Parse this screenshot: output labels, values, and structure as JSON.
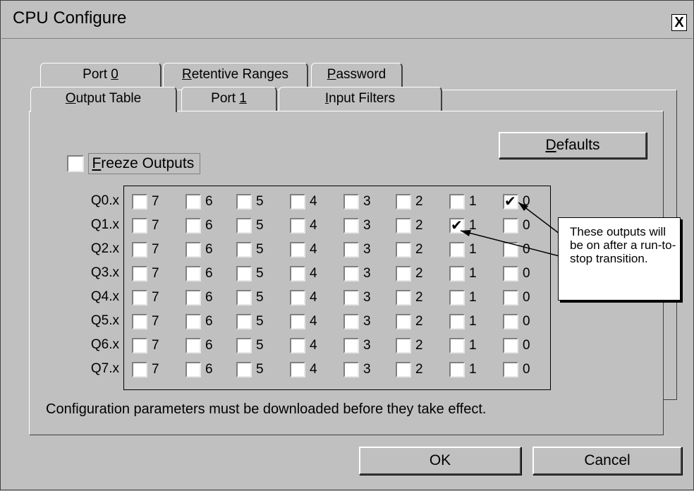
{
  "window": {
    "title": "CPU Configure",
    "close_label": "X"
  },
  "tabs_back": [
    {
      "label": "Port 0"
    },
    {
      "label": "Retentive Ranges"
    },
    {
      "label": "Password"
    }
  ],
  "tabs_front": [
    {
      "label": "Output Table",
      "active": true
    },
    {
      "label": "Port 1"
    },
    {
      "label": "Input Filters"
    }
  ],
  "freeze": {
    "label": "Freeze Outputs",
    "checked": false
  },
  "defaults_label": "Defaults",
  "output_table": {
    "rows": [
      {
        "label": "Q0.x",
        "checked_bits": [
          0
        ]
      },
      {
        "label": "Q1.x",
        "checked_bits": [
          1
        ]
      },
      {
        "label": "Q2.x",
        "checked_bits": []
      },
      {
        "label": "Q3.x",
        "checked_bits": []
      },
      {
        "label": "Q4.x",
        "checked_bits": []
      },
      {
        "label": "Q5.x",
        "checked_bits": []
      },
      {
        "label": "Q6.x",
        "checked_bits": []
      },
      {
        "label": "Q7.x",
        "checked_bits": []
      }
    ],
    "bits": [
      "7",
      "6",
      "5",
      "4",
      "3",
      "2",
      "1",
      "0"
    ]
  },
  "callout": {
    "text": "These outputs will be on after a run-to-stop transition."
  },
  "footer_text": "Configuration parameters must be downloaded before they take effect.",
  "buttons": {
    "ok": "OK",
    "cancel": "Cancel"
  }
}
